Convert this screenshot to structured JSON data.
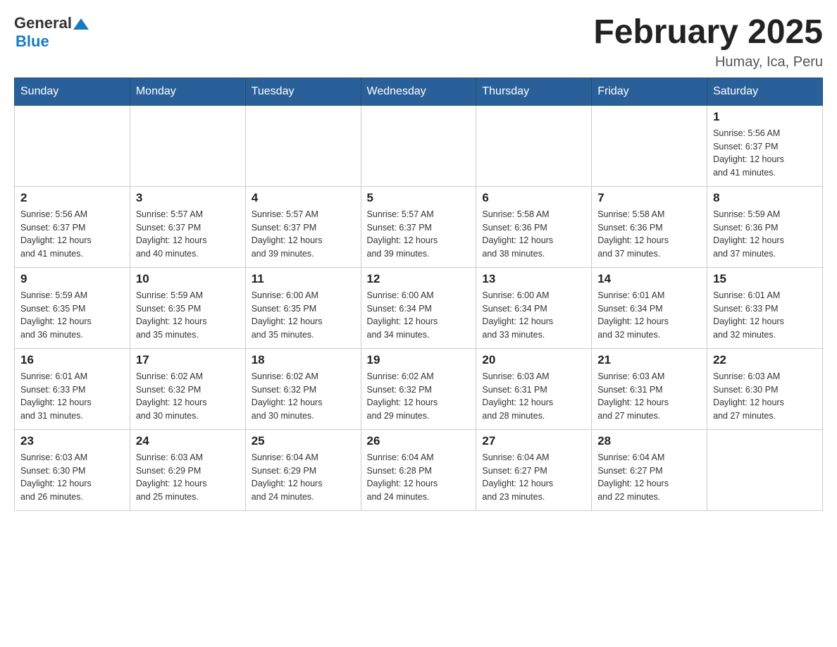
{
  "header": {
    "logo": {
      "general": "General",
      "blue": "Blue"
    },
    "title": "February 2025",
    "location": "Humay, Ica, Peru"
  },
  "days": [
    "Sunday",
    "Monday",
    "Tuesday",
    "Wednesday",
    "Thursday",
    "Friday",
    "Saturday"
  ],
  "weeks": [
    [
      {
        "date": "",
        "info": ""
      },
      {
        "date": "",
        "info": ""
      },
      {
        "date": "",
        "info": ""
      },
      {
        "date": "",
        "info": ""
      },
      {
        "date": "",
        "info": ""
      },
      {
        "date": "",
        "info": ""
      },
      {
        "date": "1",
        "info": "Sunrise: 5:56 AM\nSunset: 6:37 PM\nDaylight: 12 hours\nand 41 minutes."
      }
    ],
    [
      {
        "date": "2",
        "info": "Sunrise: 5:56 AM\nSunset: 6:37 PM\nDaylight: 12 hours\nand 41 minutes."
      },
      {
        "date": "3",
        "info": "Sunrise: 5:57 AM\nSunset: 6:37 PM\nDaylight: 12 hours\nand 40 minutes."
      },
      {
        "date": "4",
        "info": "Sunrise: 5:57 AM\nSunset: 6:37 PM\nDaylight: 12 hours\nand 39 minutes."
      },
      {
        "date": "5",
        "info": "Sunrise: 5:57 AM\nSunset: 6:37 PM\nDaylight: 12 hours\nand 39 minutes."
      },
      {
        "date": "6",
        "info": "Sunrise: 5:58 AM\nSunset: 6:36 PM\nDaylight: 12 hours\nand 38 minutes."
      },
      {
        "date": "7",
        "info": "Sunrise: 5:58 AM\nSunset: 6:36 PM\nDaylight: 12 hours\nand 37 minutes."
      },
      {
        "date": "8",
        "info": "Sunrise: 5:59 AM\nSunset: 6:36 PM\nDaylight: 12 hours\nand 37 minutes."
      }
    ],
    [
      {
        "date": "9",
        "info": "Sunrise: 5:59 AM\nSunset: 6:35 PM\nDaylight: 12 hours\nand 36 minutes."
      },
      {
        "date": "10",
        "info": "Sunrise: 5:59 AM\nSunset: 6:35 PM\nDaylight: 12 hours\nand 35 minutes."
      },
      {
        "date": "11",
        "info": "Sunrise: 6:00 AM\nSunset: 6:35 PM\nDaylight: 12 hours\nand 35 minutes."
      },
      {
        "date": "12",
        "info": "Sunrise: 6:00 AM\nSunset: 6:34 PM\nDaylight: 12 hours\nand 34 minutes."
      },
      {
        "date": "13",
        "info": "Sunrise: 6:00 AM\nSunset: 6:34 PM\nDaylight: 12 hours\nand 33 minutes."
      },
      {
        "date": "14",
        "info": "Sunrise: 6:01 AM\nSunset: 6:34 PM\nDaylight: 12 hours\nand 32 minutes."
      },
      {
        "date": "15",
        "info": "Sunrise: 6:01 AM\nSunset: 6:33 PM\nDaylight: 12 hours\nand 32 minutes."
      }
    ],
    [
      {
        "date": "16",
        "info": "Sunrise: 6:01 AM\nSunset: 6:33 PM\nDaylight: 12 hours\nand 31 minutes."
      },
      {
        "date": "17",
        "info": "Sunrise: 6:02 AM\nSunset: 6:32 PM\nDaylight: 12 hours\nand 30 minutes."
      },
      {
        "date": "18",
        "info": "Sunrise: 6:02 AM\nSunset: 6:32 PM\nDaylight: 12 hours\nand 30 minutes."
      },
      {
        "date": "19",
        "info": "Sunrise: 6:02 AM\nSunset: 6:32 PM\nDaylight: 12 hours\nand 29 minutes."
      },
      {
        "date": "20",
        "info": "Sunrise: 6:03 AM\nSunset: 6:31 PM\nDaylight: 12 hours\nand 28 minutes."
      },
      {
        "date": "21",
        "info": "Sunrise: 6:03 AM\nSunset: 6:31 PM\nDaylight: 12 hours\nand 27 minutes."
      },
      {
        "date": "22",
        "info": "Sunrise: 6:03 AM\nSunset: 6:30 PM\nDaylight: 12 hours\nand 27 minutes."
      }
    ],
    [
      {
        "date": "23",
        "info": "Sunrise: 6:03 AM\nSunset: 6:30 PM\nDaylight: 12 hours\nand 26 minutes."
      },
      {
        "date": "24",
        "info": "Sunrise: 6:03 AM\nSunset: 6:29 PM\nDaylight: 12 hours\nand 25 minutes."
      },
      {
        "date": "25",
        "info": "Sunrise: 6:04 AM\nSunset: 6:29 PM\nDaylight: 12 hours\nand 24 minutes."
      },
      {
        "date": "26",
        "info": "Sunrise: 6:04 AM\nSunset: 6:28 PM\nDaylight: 12 hours\nand 24 minutes."
      },
      {
        "date": "27",
        "info": "Sunrise: 6:04 AM\nSunset: 6:27 PM\nDaylight: 12 hours\nand 23 minutes."
      },
      {
        "date": "28",
        "info": "Sunrise: 6:04 AM\nSunset: 6:27 PM\nDaylight: 12 hours\nand 22 minutes."
      },
      {
        "date": "",
        "info": ""
      }
    ]
  ]
}
